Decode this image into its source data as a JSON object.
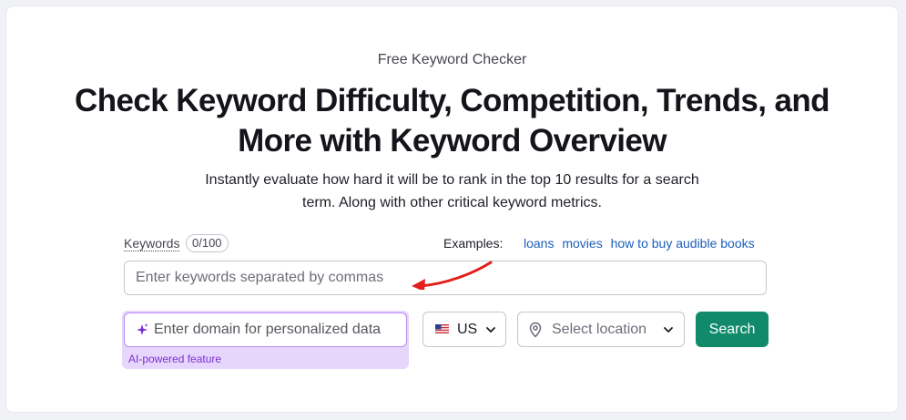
{
  "hero": {
    "eyebrow": "Free Keyword Checker",
    "headline": "Check Keyword Difficulty, Competition, Trends, and More with Keyword Overview",
    "subtext": "Instantly evaluate how hard it will be to rank in the top 10 results for a search term. Along with other critical keyword metrics."
  },
  "keywords": {
    "label": "Keywords",
    "counter": "0/100",
    "placeholder": "Enter keywords separated by commas",
    "value": ""
  },
  "examples": {
    "label": "Examples:",
    "items": [
      "loans",
      "movies",
      "how to buy audible books"
    ]
  },
  "domain": {
    "placeholder": "Enter domain for personalized data",
    "value": "",
    "caption": "AI-powered feature",
    "icon": "sparkle-icon"
  },
  "country": {
    "selected": "US",
    "icon": "us-flag-icon"
  },
  "location": {
    "placeholder": "Select location",
    "icon": "location-pin-icon"
  },
  "search_button": {
    "label": "Search"
  },
  "colors": {
    "accent_green": "#118a6b",
    "link_blue": "#1b5fbd",
    "ai_purple": "#7a2fd6",
    "annotation_red": "#e3201b"
  }
}
